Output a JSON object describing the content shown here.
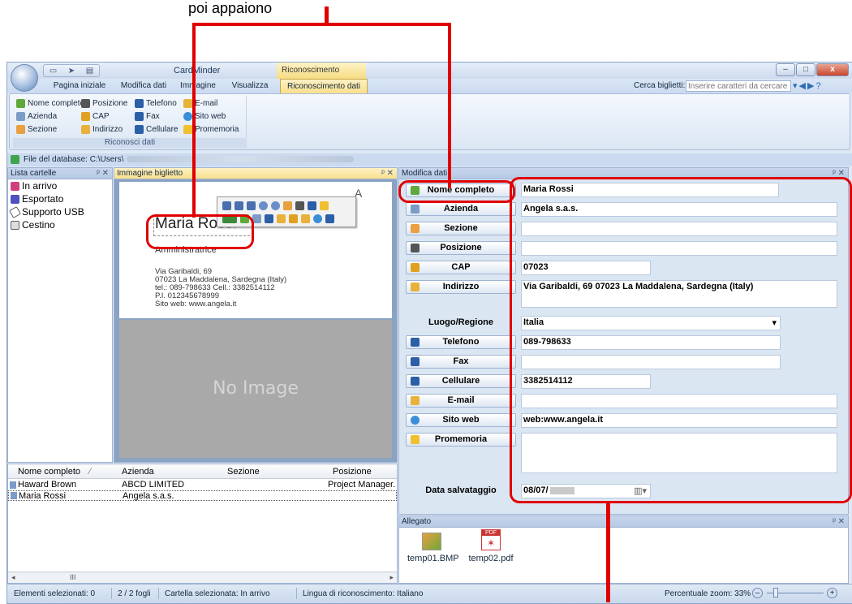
{
  "annotation": {
    "top_text": "poi appaiono"
  },
  "window": {
    "title": "CardMinder",
    "context_tab": "Riconoscimento",
    "qat_icons": [
      "new-card-icon",
      "pointer-icon",
      "scanner-icon"
    ],
    "buttons": {
      "minimize": "–",
      "maximize": "□",
      "close": "x"
    }
  },
  "tabs": [
    {
      "label": "Pagina iniziale"
    },
    {
      "label": "Modifica dati"
    },
    {
      "label": "Immagine"
    },
    {
      "label": "Visualizza"
    },
    {
      "label": "Riconoscimento dati"
    }
  ],
  "search": {
    "label": "Cerca biglietti:",
    "placeholder": "Inserire caratteri da cercare"
  },
  "ribbon": {
    "group_label": "Riconosci dati",
    "buttons": [
      {
        "label": "Nome completo",
        "color": "#5fa83a"
      },
      {
        "label": "Posizione",
        "color": "#555555"
      },
      {
        "label": "Telefono",
        "color": "#2b5fa8"
      },
      {
        "label": "E-mail",
        "color": "#e8b13a"
      },
      {
        "label": "Azienda",
        "color": "#7a9cc7"
      },
      {
        "label": "CAP",
        "color": "#e0a020"
      },
      {
        "label": "Fax",
        "color": "#2b5fa8"
      },
      {
        "label": "Sito web",
        "color": "#3a8fd8"
      },
      {
        "label": "Sezione",
        "color": "#e8a040"
      },
      {
        "label": "Indirizzo",
        "color": "#e8b13a"
      },
      {
        "label": "Cellulare",
        "color": "#2b5fa8"
      },
      {
        "label": "Promemoria",
        "color": "#f0c030"
      }
    ]
  },
  "database": {
    "label": "File del database: C:\\Users\\"
  },
  "folders": {
    "title": "Lista cartelle",
    "items": [
      {
        "label": "In arrivo",
        "color": "#d04080"
      },
      {
        "label": "Esportato",
        "color": "#5050c0"
      },
      {
        "label": "Supporto USB",
        "color": "#606060"
      },
      {
        "label": "Cestino",
        "color": "#606060"
      }
    ]
  },
  "image_pane": {
    "title": "Immagine biglietto",
    "no_image": "No Image",
    "card": {
      "company_partial": "A",
      "name": "Maria Rossi",
      "role": "Amministratrice",
      "lines": [
        "Via Garibaldi, 69",
        "07023 La Maddalena, Sardegna (Italy)",
        "tel.: 089-798633   Cell.: 3382514112",
        "P.I. 012345678999",
        "Sito web: www.angela.it"
      ]
    }
  },
  "card_list": {
    "columns": [
      "Nome completo",
      "Azienda",
      "Sezione",
      "Posizione"
    ],
    "rows": [
      {
        "name": "Haward Brown",
        "company": "ABCD LIMITED",
        "section": "",
        "position": "Project Manager."
      },
      {
        "name": "Maria Rossi",
        "company": "Angela s.a.s.",
        "section": "",
        "position": ""
      }
    ],
    "scroll_marker": "III"
  },
  "edit_pane": {
    "title": "Modifica dati",
    "fields": [
      {
        "label": "Nome completo",
        "value": "Maria Rossi",
        "icon_color": "#5fa83a"
      },
      {
        "label": "Azienda",
        "value": "Angela s.a.s.",
        "icon_color": "#7a9cc7"
      },
      {
        "label": "Sezione",
        "value": "",
        "icon_color": "#e8a040"
      },
      {
        "label": "Posizione",
        "value": "",
        "icon_color": "#555555"
      },
      {
        "label": "CAP",
        "value": "07023",
        "icon_color": "#e0a020"
      },
      {
        "label": "Indirizzo",
        "value": "Via Garibaldi, 69 07023 La Maddalena, Sardegna (Italy)",
        "icon_color": "#e8b13a"
      },
      {
        "label": "Telefono",
        "value": "089-798633",
        "icon_color": "#2b5fa8"
      },
      {
        "label": "Fax",
        "value": "",
        "icon_color": "#2b5fa8"
      },
      {
        "label": "Cellulare",
        "value": "3382514112",
        "icon_color": "#2b5fa8"
      },
      {
        "label": "E-mail",
        "value": "",
        "icon_color": "#e8b13a"
      },
      {
        "label": "Sito web",
        "value": "web:www.angela.it",
        "icon_color": "#3a8fd8"
      },
      {
        "label": "Promemoria",
        "value": "",
        "icon_color": "#f0c030"
      }
    ],
    "region_label": "Luogo/Regione",
    "region_value": "Italia",
    "date_label": "Data salvataggio",
    "date_value": "08/07/"
  },
  "attachments": {
    "title": "Allegato",
    "files": [
      {
        "name": "temp01.BMP"
      },
      {
        "name": "temp02.pdf",
        "badge": "PDF"
      }
    ]
  },
  "status": {
    "selected": "Elementi selezionati:   0",
    "sheets": "2 / 2 fogli",
    "folder": "Cartella selezionata: In arrivo",
    "language": "Lingua di riconoscimento: Italiano",
    "zoom": "Percentuale zoom: 33%"
  },
  "colors": {
    "annotation_red": "#e00000"
  }
}
